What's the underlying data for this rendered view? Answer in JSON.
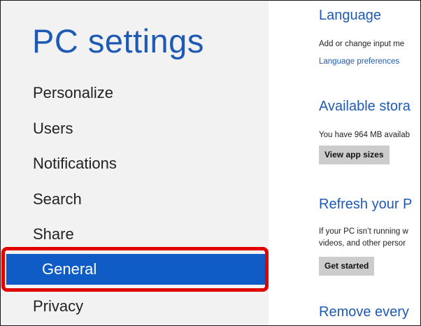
{
  "sidebar": {
    "title": "PC settings",
    "items": [
      {
        "label": "Personalize"
      },
      {
        "label": "Users"
      },
      {
        "label": "Notifications"
      },
      {
        "label": "Search"
      },
      {
        "label": "Share"
      },
      {
        "label": "General",
        "selected": true
      },
      {
        "label": "Privacy"
      }
    ]
  },
  "content": {
    "language": {
      "heading": "Language",
      "description": "Add or change input me",
      "link": "Language preferences"
    },
    "storage": {
      "heading": "Available stora",
      "description": "You have 964 MB availab",
      "button": "View app sizes"
    },
    "refresh": {
      "heading": "Refresh your P",
      "description_line1": "If your PC isn’t running w",
      "description_line2": "videos, and other persor",
      "button": "Get started"
    },
    "remove": {
      "heading": "Remove every"
    }
  },
  "colors": {
    "accent": "#1e5ab4",
    "selected_background": "#0f5cc6",
    "highlight_outline": "#e00000",
    "sidebar_background": "#f2f2f2"
  }
}
